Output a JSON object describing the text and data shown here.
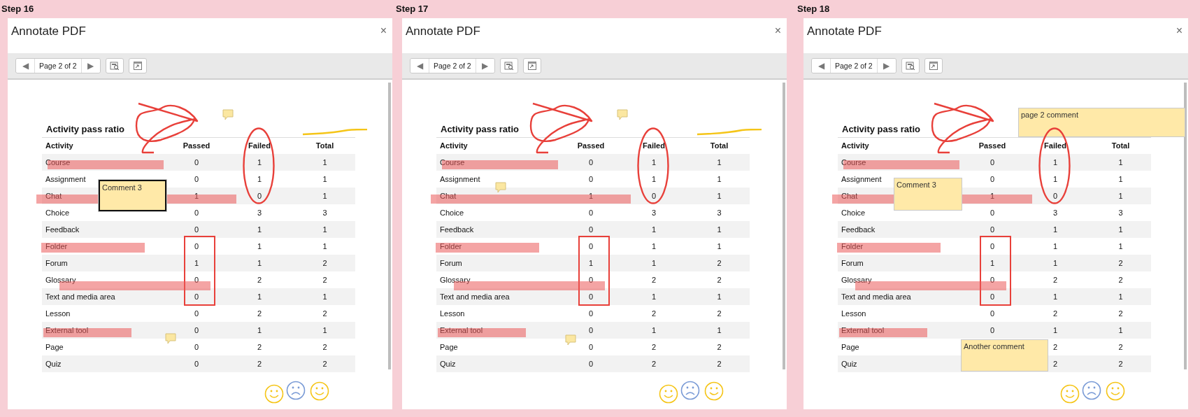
{
  "steps": [
    {
      "label": "Step 16",
      "dialog": {
        "title": "Annotate PDF",
        "close": "×",
        "toolbar": {
          "prev": "◀",
          "page": "Page 2 of 2",
          "next": "▶"
        },
        "document": {
          "title": "Activity pass ratio",
          "columns": [
            "Activity",
            "Passed",
            "Failed",
            "Total"
          ],
          "rows": [
            [
              "Course",
              "0",
              "1",
              "1"
            ],
            [
              "Assignment",
              "0",
              "1",
              "1"
            ],
            [
              "Chat",
              "1",
              "0",
              "1"
            ],
            [
              "Choice",
              "0",
              "3",
              "3"
            ],
            [
              "Feedback",
              "0",
              "1",
              "1"
            ],
            [
              "Folder",
              "0",
              "1",
              "1"
            ],
            [
              "Forum",
              "1",
              "1",
              "2"
            ],
            [
              "Glossary",
              "0",
              "2",
              "2"
            ],
            [
              "Text and media area",
              "0",
              "1",
              "1"
            ],
            [
              "Lesson",
              "0",
              "2",
              "2"
            ],
            [
              "External tool",
              "0",
              "1",
              "1"
            ],
            [
              "Page",
              "0",
              "2",
              "2"
            ],
            [
              "Quiz",
              "0",
              "2",
              "2"
            ]
          ]
        },
        "annotations": [
          {
            "kind": "scribble"
          },
          {
            "kind": "note"
          },
          {
            "kind": "line"
          },
          {
            "kind": "ellipse"
          },
          {
            "kind": "rectangle"
          },
          {
            "kind": "highlight"
          },
          {
            "kind": "highlight"
          },
          {
            "kind": "highlight"
          },
          {
            "kind": "highlight"
          },
          {
            "kind": "highlight"
          },
          {
            "kind": "comment",
            "text": "Comment 3",
            "selected": true
          },
          {
            "kind": "note"
          },
          {
            "kind": "smiley"
          },
          {
            "kind": "frown"
          },
          {
            "kind": "smiley"
          }
        ]
      }
    },
    {
      "label": "Step 17",
      "dialog": {
        "title": "Annotate PDF",
        "close": "×",
        "toolbar": {
          "prev": "◀",
          "page": "Page 2 of 2",
          "next": "▶"
        },
        "document": {
          "title": "Activity pass ratio",
          "columns": [
            "Activity",
            "Passed",
            "Failed",
            "Total"
          ],
          "rows": [
            [
              "Course",
              "0",
              "1",
              "1"
            ],
            [
              "Assignment",
              "0",
              "1",
              "1"
            ],
            [
              "Chat",
              "1",
              "0",
              "1"
            ],
            [
              "Choice",
              "0",
              "3",
              "3"
            ],
            [
              "Feedback",
              "0",
              "1",
              "1"
            ],
            [
              "Folder",
              "0",
              "1",
              "1"
            ],
            [
              "Forum",
              "1",
              "1",
              "2"
            ],
            [
              "Glossary",
              "0",
              "2",
              "2"
            ],
            [
              "Text and media area",
              "0",
              "1",
              "1"
            ],
            [
              "Lesson",
              "0",
              "2",
              "2"
            ],
            [
              "External tool",
              "0",
              "1",
              "1"
            ],
            [
              "Page",
              "0",
              "2",
              "2"
            ],
            [
              "Quiz",
              "0",
              "2",
              "2"
            ]
          ]
        },
        "annotations": [
          {
            "kind": "scribble"
          },
          {
            "kind": "note"
          },
          {
            "kind": "line"
          },
          {
            "kind": "ellipse"
          },
          {
            "kind": "rectangle"
          },
          {
            "kind": "highlight"
          },
          {
            "kind": "highlight"
          },
          {
            "kind": "highlight"
          },
          {
            "kind": "highlight"
          },
          {
            "kind": "highlight"
          },
          {
            "kind": "note"
          },
          {
            "kind": "note"
          },
          {
            "kind": "smiley"
          },
          {
            "kind": "frown"
          },
          {
            "kind": "smiley"
          }
        ]
      }
    },
    {
      "label": "Step 18",
      "dialog": {
        "title": "Annotate PDF",
        "close": "×",
        "toolbar": {
          "prev": "◀",
          "page": "Page 2 of 2",
          "next": "▶"
        },
        "document": {
          "title": "Activity pass ratio",
          "columns": [
            "Activity",
            "Passed",
            "Failed",
            "Total"
          ],
          "rows": [
            [
              "Course",
              "0",
              "1",
              "1"
            ],
            [
              "Assignment",
              "0",
              "1",
              "1"
            ],
            [
              "Chat",
              "1",
              "0",
              "1"
            ],
            [
              "Choice",
              "0",
              "3",
              "3"
            ],
            [
              "Feedback",
              "0",
              "1",
              "1"
            ],
            [
              "Folder",
              "0",
              "1",
              "1"
            ],
            [
              "Forum",
              "1",
              "1",
              "2"
            ],
            [
              "Glossary",
              "0",
              "2",
              "2"
            ],
            [
              "Text and media area",
              "0",
              "1",
              "1"
            ],
            [
              "Lesson",
              "0",
              "2",
              "2"
            ],
            [
              "External tool",
              "0",
              "1",
              "1"
            ],
            [
              "Page",
              null,
              "2",
              "2"
            ],
            [
              "Quiz",
              null,
              "2",
              "2"
            ]
          ]
        },
        "annotations": [
          {
            "kind": "scribble"
          },
          {
            "kind": "comment",
            "text": "page 2 comment",
            "selected": false
          },
          {
            "kind": "ellipse"
          },
          {
            "kind": "rectangle"
          },
          {
            "kind": "highlight"
          },
          {
            "kind": "highlight"
          },
          {
            "kind": "highlight"
          },
          {
            "kind": "highlight"
          },
          {
            "kind": "highlight"
          },
          {
            "kind": "comment",
            "text": "Comment 3",
            "selected": false
          },
          {
            "kind": "comment",
            "text": "Another comment",
            "selected": false
          },
          {
            "kind": "smiley"
          },
          {
            "kind": "frown"
          },
          {
            "kind": "smiley"
          }
        ]
      }
    }
  ]
}
